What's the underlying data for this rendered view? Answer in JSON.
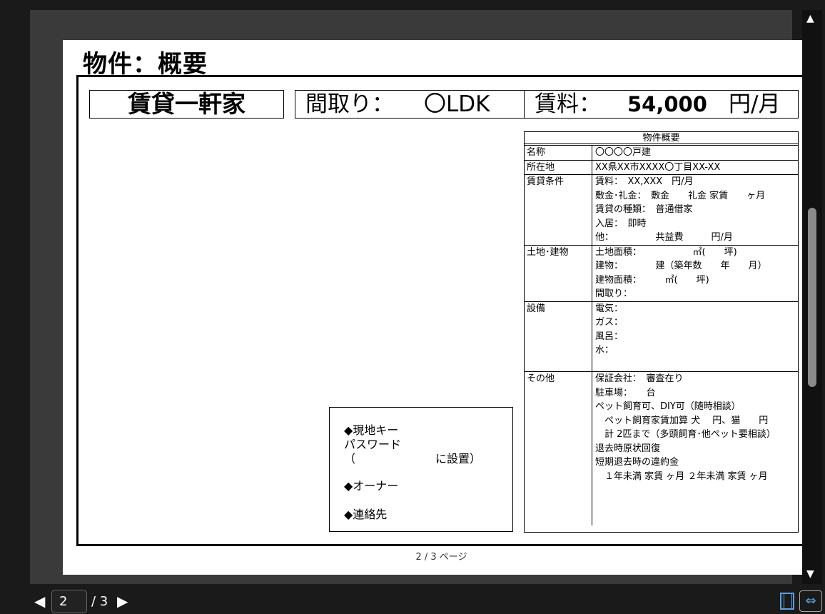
{
  "document": {
    "title": "物件：概要",
    "property_type": "賃貸一軒家",
    "layout_label": "間取り：",
    "layout_value": "〇LDK",
    "rent_label": "賃料：",
    "rent_value": "54,000",
    "rent_unit": "円/月",
    "outline": {
      "title": "物件概要",
      "rows": [
        {
          "label": "名称",
          "values": [
            "〇〇〇〇戸建"
          ]
        },
        {
          "label": "所在地",
          "values": [
            "XX県XX市XXXX〇丁目XX-XX"
          ]
        },
        {
          "label": "賃貸条件",
          "values": [
            " 賃料：　XX,XXX　円/月",
            "敷金･礼金：　敷金　　礼金 家賃　　ヶ月",
            "賃貸の種類：　普通借家",
            "入居：　即時",
            "他：　　　　　共益費　　　円/月"
          ]
        },
        {
          "label": "土地･建物",
          "values": [
            "土地面積：　　　　　　㎡(　　坪)",
            "建物：　　　　建（築年数　　年　　月）",
            "建物面積：　　　㎡(　　坪)",
            "間取り："
          ]
        },
        {
          "label": "設備",
          "values": [
            "電気：",
            "ガス：",
            "風呂：",
            "水：",
            ""
          ]
        },
        {
          "label": "その他",
          "values": [
            "保証会社：　審査在り",
            "駐車場：　　台",
            "ペット飼育可、DIY可（随時相談）",
            "　ペット飼育家賃加算 犬　 円、猫　　円",
            "　計 2匹まで（多頭飼育･他ペット要相談）",
            "退去時原状回復",
            "短期退去時の違約金",
            "　１年未満 家賃 ヶ月 ２年未満 家賃 ヶ月",
            "",
            "",
            ""
          ]
        }
      ]
    },
    "memo": {
      "key_label": "◆現地キー",
      "password_label": "パスワード",
      "placement": "（　　　　　　　に設置）",
      "owner_label": "◆オーナー",
      "contact_label": "◆連絡先"
    },
    "footer": "2 / 3 ページ"
  },
  "viewer": {
    "current_page": "2",
    "total_pages": "/ 3"
  },
  "icons": {
    "prev": "◀",
    "next": "▶",
    "scroll_up": "▲",
    "scroll_down": "▼",
    "pan": "⇔"
  }
}
